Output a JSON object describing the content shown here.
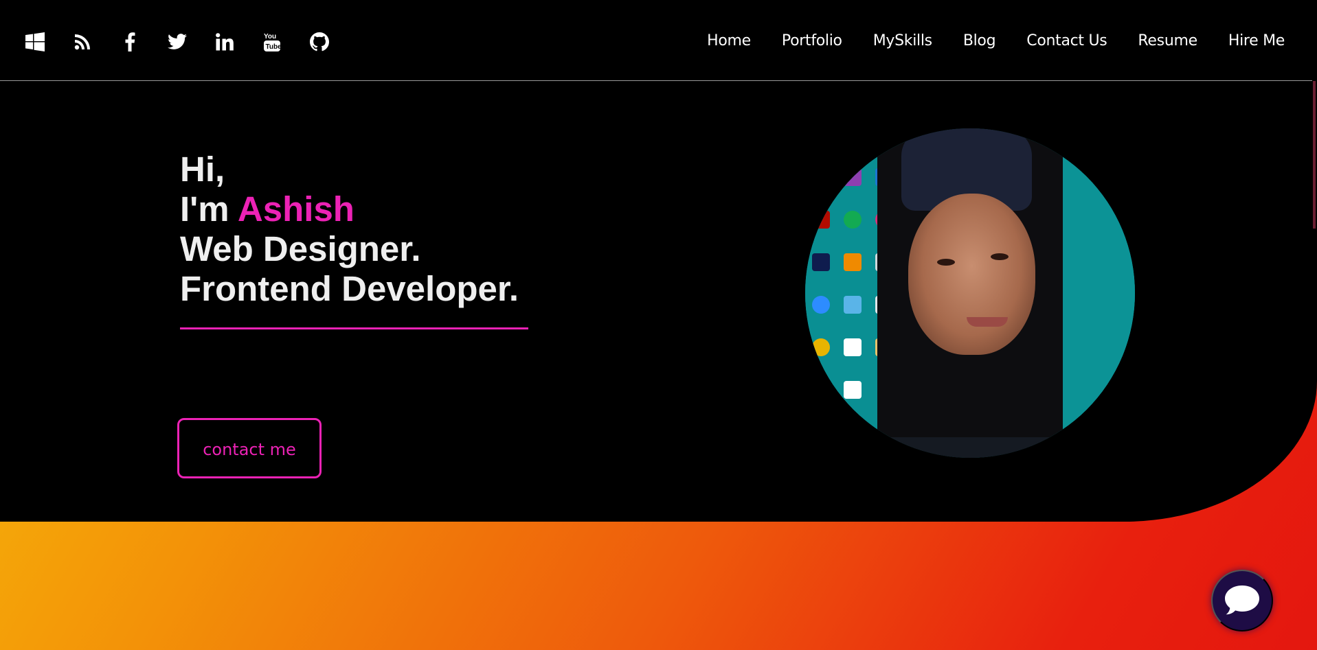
{
  "navbar": {
    "social_icons": [
      "windows-icon",
      "rss-icon",
      "facebook-icon",
      "twitter-icon",
      "linkedin-icon",
      "youtube-icon",
      "github-icon"
    ],
    "links": [
      "Home",
      "Portfolio",
      "MySkills",
      "Blog",
      "Contact Us",
      "Resume",
      "Hire Me"
    ]
  },
  "hero": {
    "line1": "Hi,",
    "line2_prefix": "I'm ",
    "name": "Ashish",
    "line3": "Web Designer.",
    "line4": "Frontend Developer.",
    "button_label": "contact me"
  },
  "colors": {
    "accent": "#ec22b5",
    "background": "#000000",
    "chat_button": "#1e0c45"
  }
}
